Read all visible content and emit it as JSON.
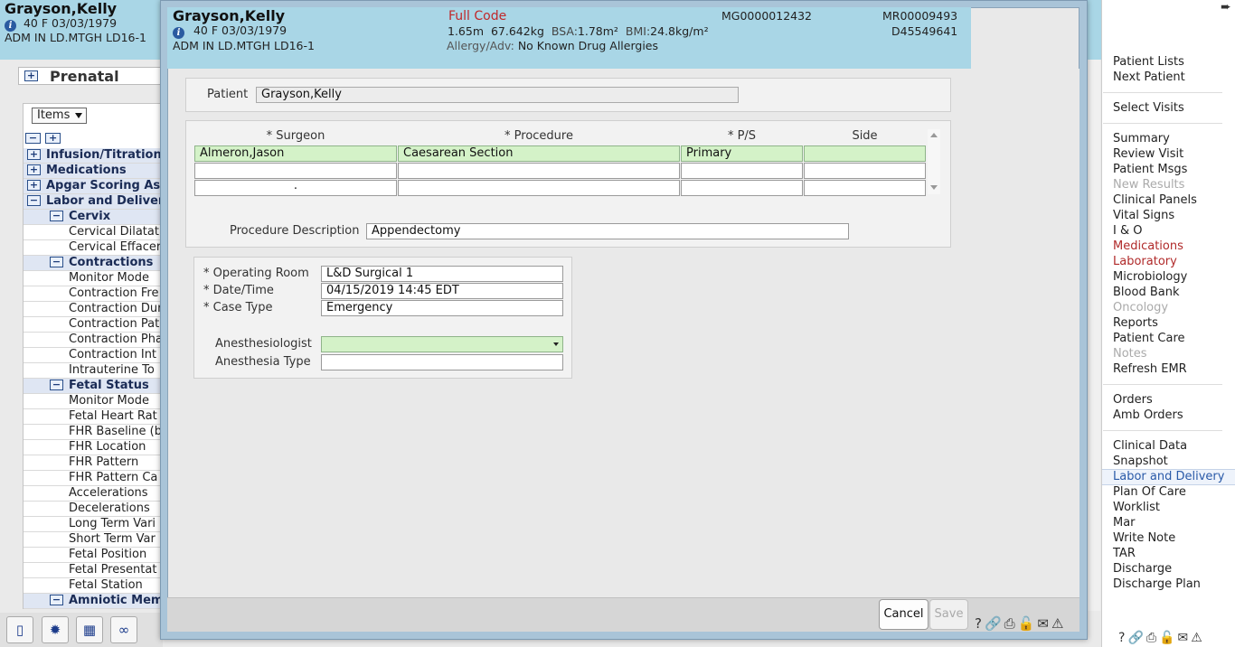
{
  "background": {
    "patient_name": "Grayson,Kelly",
    "line1": "40  F  03/03/1979",
    "line2": "ADM IN  LD.MTGH  LD16-1",
    "section_title": "Prenatal",
    "items_select": "Items",
    "tree": [
      {
        "label": "Infusion/Titration",
        "kind": "sec",
        "state": "+"
      },
      {
        "label": "Medications",
        "kind": "sec",
        "state": "+"
      },
      {
        "label": "Apgar Scoring As",
        "kind": "sec",
        "state": "+"
      },
      {
        "label": "Labor and Deliver",
        "kind": "sec",
        "state": "−"
      },
      {
        "label": "Cervix",
        "kind": "sub",
        "state": "−"
      },
      {
        "label": "Cervical Dilatat",
        "kind": "leaf"
      },
      {
        "label": "Cervical Effacer",
        "kind": "leaf"
      },
      {
        "label": "Contractions",
        "kind": "sub",
        "state": "−"
      },
      {
        "label": "Monitor Mode",
        "kind": "leaf"
      },
      {
        "label": "Contraction Fre",
        "kind": "leaf"
      },
      {
        "label": "Contraction Dur",
        "kind": "leaf"
      },
      {
        "label": "Contraction Pat",
        "kind": "leaf"
      },
      {
        "label": "Contraction Pha",
        "kind": "leaf"
      },
      {
        "label": "Contraction Int",
        "kind": "leaf"
      },
      {
        "label": "Intrauterine To",
        "kind": "leaf"
      },
      {
        "label": "Fetal Status",
        "kind": "sub",
        "state": "−"
      },
      {
        "label": "Monitor Mode",
        "kind": "leaf"
      },
      {
        "label": "Fetal Heart Rat",
        "kind": "leaf"
      },
      {
        "label": "FHR Baseline (b",
        "kind": "leaf"
      },
      {
        "label": "FHR Location",
        "kind": "leaf"
      },
      {
        "label": "FHR Pattern",
        "kind": "leaf"
      },
      {
        "label": "FHR Pattern Ca",
        "kind": "leaf"
      },
      {
        "label": "Accelerations",
        "kind": "leaf"
      },
      {
        "label": "Decelerations",
        "kind": "leaf"
      },
      {
        "label": "Long Term Vari",
        "kind": "leaf"
      },
      {
        "label": "Short Term Var",
        "kind": "leaf"
      },
      {
        "label": "Fetal Position",
        "kind": "leaf"
      },
      {
        "label": "Fetal Presentat",
        "kind": "leaf"
      },
      {
        "label": "Fetal Station",
        "kind": "leaf"
      },
      {
        "label": "Amniotic Mem",
        "kind": "sub",
        "state": "−"
      }
    ]
  },
  "right_nav": {
    "groups": [
      [
        {
          "label": "Patient Lists"
        },
        {
          "label": "Next Patient"
        }
      ],
      [
        {
          "label": "Select Visits"
        }
      ],
      [
        {
          "label": "Summary"
        },
        {
          "label": "Review Visit"
        },
        {
          "label": "Patient Msgs"
        },
        {
          "label": "New Results",
          "state": "dis"
        },
        {
          "label": "Clinical Panels"
        },
        {
          "label": "Vital Signs"
        },
        {
          "label": "I & O"
        },
        {
          "label": "Medications",
          "state": "red"
        },
        {
          "label": "Laboratory",
          "state": "red"
        },
        {
          "label": "Microbiology"
        },
        {
          "label": "Blood Bank"
        },
        {
          "label": "Oncology",
          "state": "dis"
        },
        {
          "label": "Reports"
        },
        {
          "label": "Patient Care"
        },
        {
          "label": "Notes",
          "state": "dis"
        },
        {
          "label": "Refresh EMR"
        }
      ],
      [
        {
          "label": "Orders"
        },
        {
          "label": "Amb Orders"
        }
      ],
      [
        {
          "label": "Clinical Data"
        },
        {
          "label": "Snapshot"
        },
        {
          "label": "Labor and Delivery",
          "state": "sel"
        },
        {
          "label": "Plan Of Care"
        },
        {
          "label": "Worklist"
        },
        {
          "label": "Mar"
        },
        {
          "label": "Write Note"
        },
        {
          "label": "TAR"
        },
        {
          "label": "Discharge"
        },
        {
          "label": "Discharge Plan"
        }
      ]
    ]
  },
  "modal": {
    "header": {
      "patient_name": "Grayson,Kelly",
      "line1": "40  F  03/03/1979",
      "line2": "ADM IN  LD.MTGH  LD16-1",
      "code_status": "Full Code",
      "height": "1.65m",
      "weight": "67.642kg",
      "bsa_label": "BSA:",
      "bsa": "1.78m²",
      "bmi_label": "BMI:",
      "bmi": "24.8kg/m²",
      "allergy_label": "Allergy/Adv:",
      "allergy": "No Known Drug Allergies",
      "mg_number": "MG0000012432",
      "mr_number": "MR00009493",
      "d_number": "D45549641"
    },
    "patient_label": "Patient",
    "patient_value": "Grayson,Kelly",
    "procedure_table": {
      "headers": [
        "* Surgeon",
        "* Procedure",
        "* P/S",
        "Side"
      ],
      "rows": [
        [
          "Almeron,Jason",
          "Caesarean Section",
          "Primary",
          ""
        ],
        [
          "",
          "",
          "",
          ""
        ],
        [
          ".",
          "",
          "",
          ""
        ]
      ]
    },
    "procedure_description_label": "Procedure Description",
    "procedure_description": "Appendectomy",
    "operating_room_label": "* Operating Room",
    "operating_room": "L&D Surgical 1",
    "datetime_label": "* Date/Time",
    "datetime": "04/15/2019 14:45 EDT",
    "case_type_label": "* Case Type",
    "case_type": "Emergency",
    "anesthesiologist_label": "Anesthesiologist",
    "anesthesiologist": "",
    "anesthesia_type_label": "Anesthesia Type",
    "anesthesia_type": "",
    "cancel_label": "Cancel",
    "save_label": "Save",
    "footer_icons": [
      "help-icon",
      "link-icon",
      "print-icon",
      "unlock-icon",
      "mail-icon",
      "warning-icon"
    ]
  },
  "toolbar_icons": [
    "trash-icon",
    "gear-icon",
    "calculator-icon",
    "people-icon"
  ]
}
